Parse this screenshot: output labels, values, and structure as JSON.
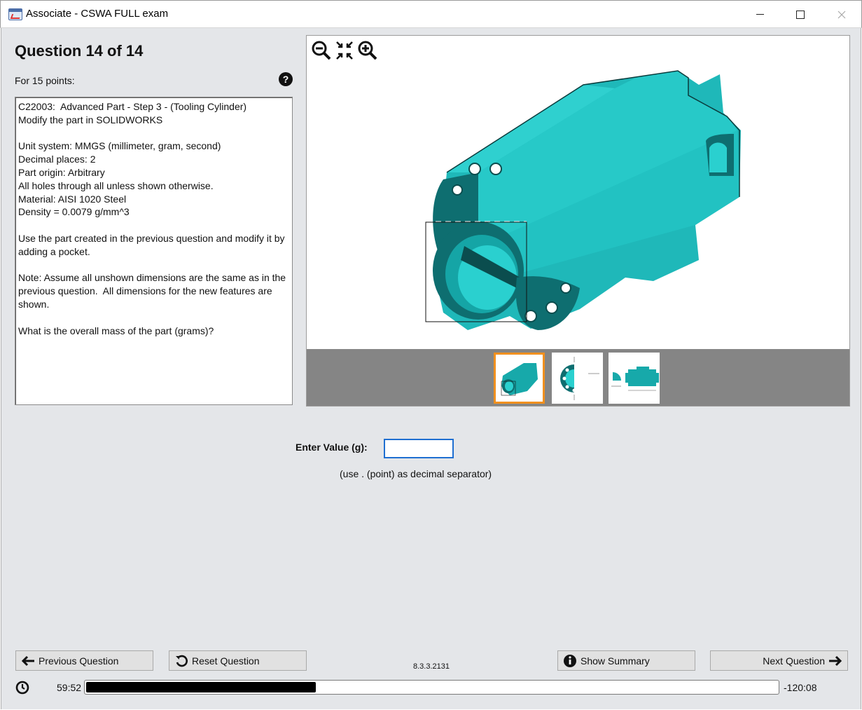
{
  "window": {
    "title": "Associate - CSWA FULL exam"
  },
  "question": {
    "title": "Question 14 of 14",
    "points": "For 15 points:",
    "help_icon": "question-circle-icon",
    "text": "C22003:  Advanced Part - Step 3 - (Tooling Cylinder)\nModify the part in SOLIDWORKS\n\nUnit system: MMGS (millimeter, gram, second)\nDecimal places: 2\nPart origin: Arbitrary\nAll holes through all unless shown otherwise.\nMaterial: AISI 1020 Steel\nDensity = 0.0079 g/mm^3\n\nUse the part created in the previous question and modify it by adding a pocket.\n\nNote: Assume all unshown dimensions are the same as in the previous question.  All dimensions for the new features are shown.\n\nWhat is the overall mass of the part (grams)?"
  },
  "viewer": {
    "tools": [
      "zoom-out-icon",
      "fit-icon",
      "zoom-in-icon"
    ],
    "part_color": "#17bfc0",
    "selected_thumbnail": 1,
    "thumbnail_highlight": "#f0901f"
  },
  "answer": {
    "label": "Enter Value (g):",
    "value": "",
    "hint": "(use . (point) as decimal separator)"
  },
  "buttons": {
    "previous": "Previous Question",
    "reset": "Reset Question",
    "summary": "Show Summary",
    "next": "Next Question"
  },
  "version": "8.3.3.2131",
  "timer": {
    "elapsed": "59:52",
    "remaining": "-120:08",
    "progress_fraction": 0.332
  }
}
